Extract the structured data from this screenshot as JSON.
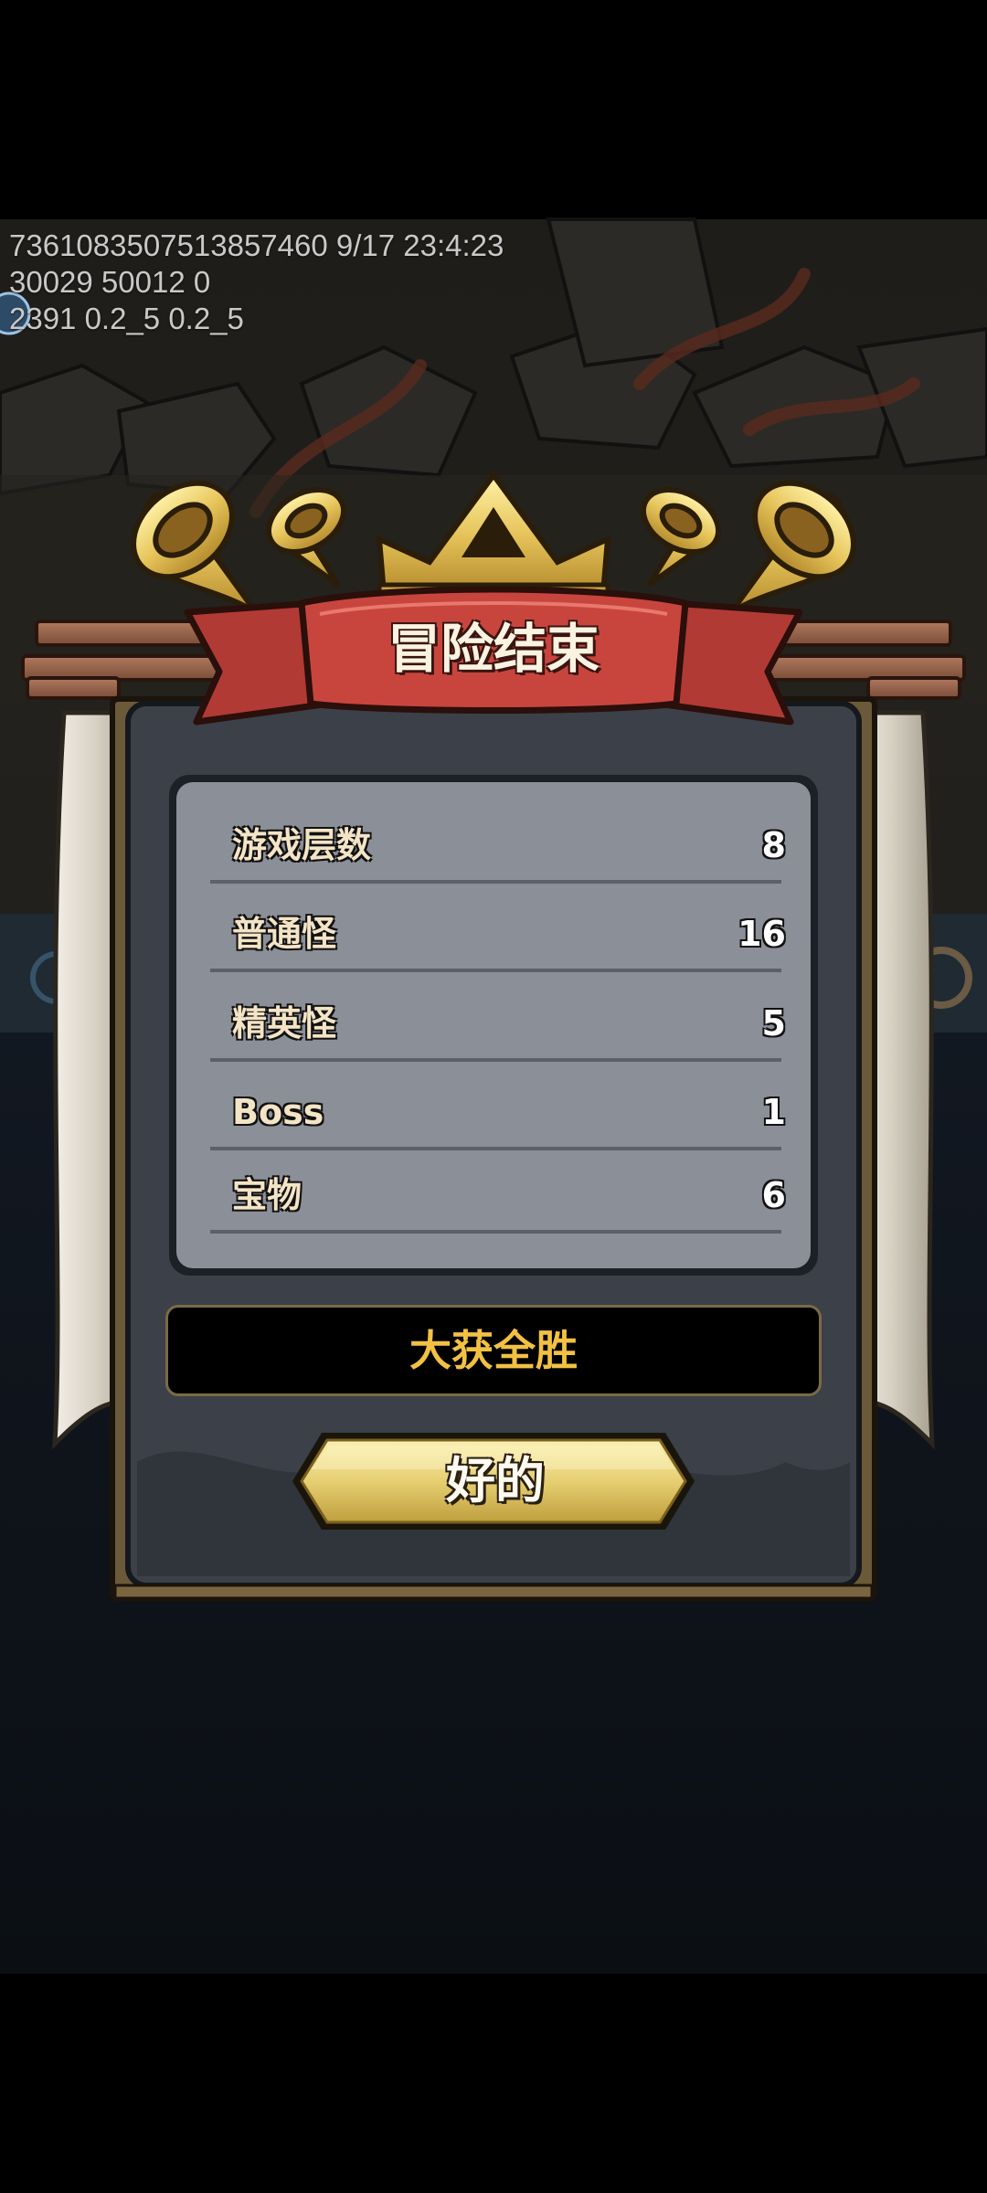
{
  "debug": {
    "line1": "7361083507513857460 9/17 23:4:23",
    "line2": "30029 50012 0",
    "line3": "2391 0.2_5 0.2_5"
  },
  "dialog": {
    "title": "冒险结束",
    "stats": [
      {
        "label": "游戏层数",
        "value": "8"
      },
      {
        "label": "普通怪",
        "value": "16"
      },
      {
        "label": "精英怪",
        "value": "5"
      },
      {
        "label": "Boss",
        "value": "1"
      },
      {
        "label": "宝物",
        "value": "6"
      }
    ],
    "result": "大获全胜",
    "ok_button": "好的"
  },
  "background": {
    "side_hint": "设置"
  },
  "colors": {
    "result_text": "#f2c143",
    "ribbon": "#c8453e",
    "gold": "#e6c45a"
  }
}
